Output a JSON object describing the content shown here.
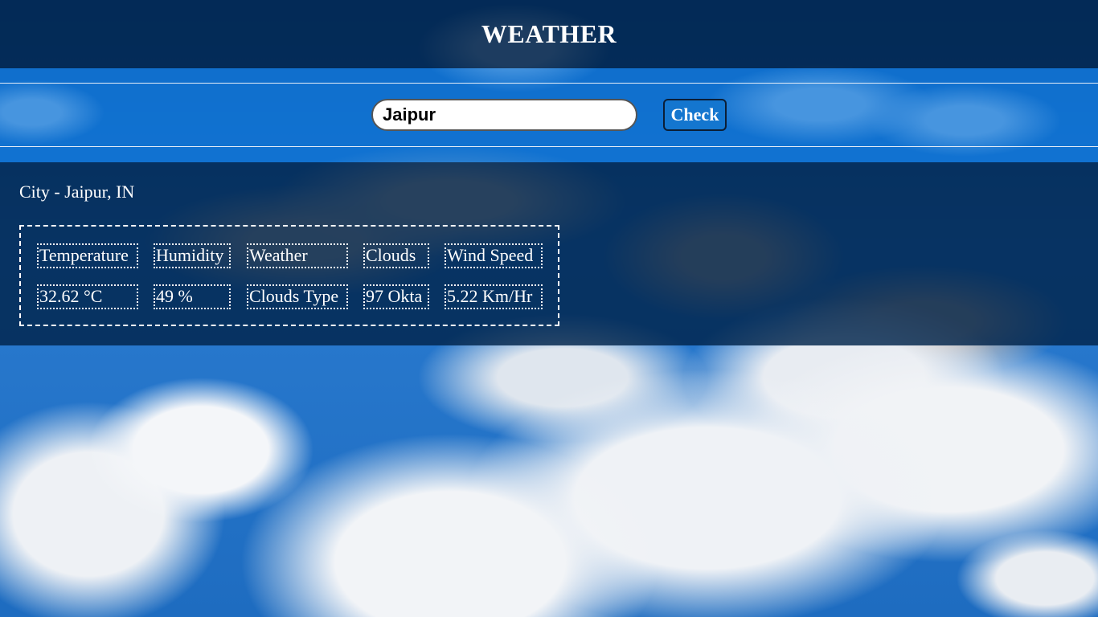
{
  "header": {
    "title": "WEATHER"
  },
  "search": {
    "value": "Jaipur",
    "button_label": "Check"
  },
  "result": {
    "city_line": "City - Jaipur, IN",
    "headers": [
      "Temperature",
      "Humidity",
      "Weather",
      "Clouds",
      "Wind Speed"
    ],
    "values": [
      "32.62 °C",
      "49 %",
      "Clouds Type",
      "97 Okta",
      "5.22 Km/Hr"
    ]
  },
  "colors": {
    "header_bg": "#00234B",
    "search_band_bg": "#0A73D7",
    "button_bg": "#1476CF",
    "text": "#FFFFFF"
  }
}
